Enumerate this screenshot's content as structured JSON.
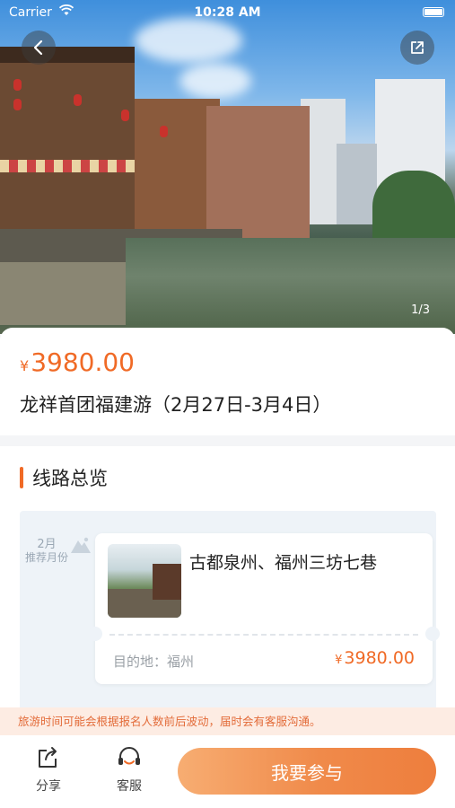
{
  "status_bar": {
    "carrier": "Carrier",
    "time": "10:28 AM"
  },
  "hero": {
    "image_counter": "1/3"
  },
  "product": {
    "currency": "¥",
    "price": "3980.00",
    "title": "龙祥首团福建游（2月27日-3月4日）"
  },
  "overview": {
    "section_title": "线路总览",
    "month": "2月",
    "month_caption": "推荐月份",
    "route": {
      "name": "古都泉州、福州三坊七巷",
      "destination": "目的地：福州",
      "currency": "¥",
      "price": "3980.00"
    }
  },
  "notice": "旅游时间可能会根据报名人数前后波动，届时会有客服沟通。",
  "bottom_bar": {
    "share_label": "分享",
    "service_label": "客服",
    "join_label": "我要参与"
  },
  "colors": {
    "accent": "#f06a26",
    "notice_bg": "#fdece3"
  },
  "icons": [
    "back-icon",
    "share-icon",
    "mountain-icon",
    "share-out-icon",
    "headset-icon"
  ]
}
